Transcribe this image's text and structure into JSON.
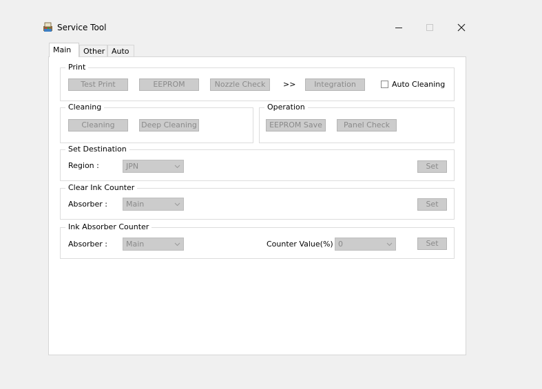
{
  "window": {
    "title": "Service Tool",
    "icon": "printer-app-icon",
    "controls": {
      "minimize": "minimize-icon",
      "maximize": "maximize-icon",
      "close": "close-icon"
    }
  },
  "tabs": [
    {
      "label": "Main",
      "active": true
    },
    {
      "label": "Other",
      "active": false
    },
    {
      "label": "Auto",
      "active": false
    }
  ],
  "print": {
    "title": "Print",
    "test_print": "Test Print",
    "eeprom": "EEPROM",
    "nozzle_check": "Nozzle Check",
    "arrow": ">>",
    "integration": "Integration",
    "auto_cleaning": "Auto Cleaning",
    "auto_cleaning_checked": false
  },
  "cleaning": {
    "title": "Cleaning",
    "cleaning": "Cleaning",
    "deep_cleaning": "Deep Cleaning"
  },
  "operation": {
    "title": "Operation",
    "eeprom_save": "EEPROM Save",
    "panel_check": "Panel Check"
  },
  "set_destination": {
    "title": "Set Destination",
    "region_label": "Region :",
    "region_value": "JPN",
    "set": "Set"
  },
  "clear_ink_counter": {
    "title": "Clear Ink Counter",
    "absorber_label": "Absorber :",
    "absorber_value": "Main",
    "set": "Set"
  },
  "ink_absorber_counter": {
    "title": "Ink Absorber Counter",
    "absorber_label": "Absorber :",
    "absorber_value": "Main",
    "counter_label": "Counter Value(%) :",
    "counter_value": "0",
    "set": "Set"
  },
  "colors": {
    "background": "#f0f0f0",
    "panel": "#ffffff",
    "disabled_button": "#cccccc",
    "disabled_text": "#8a8a8a"
  }
}
